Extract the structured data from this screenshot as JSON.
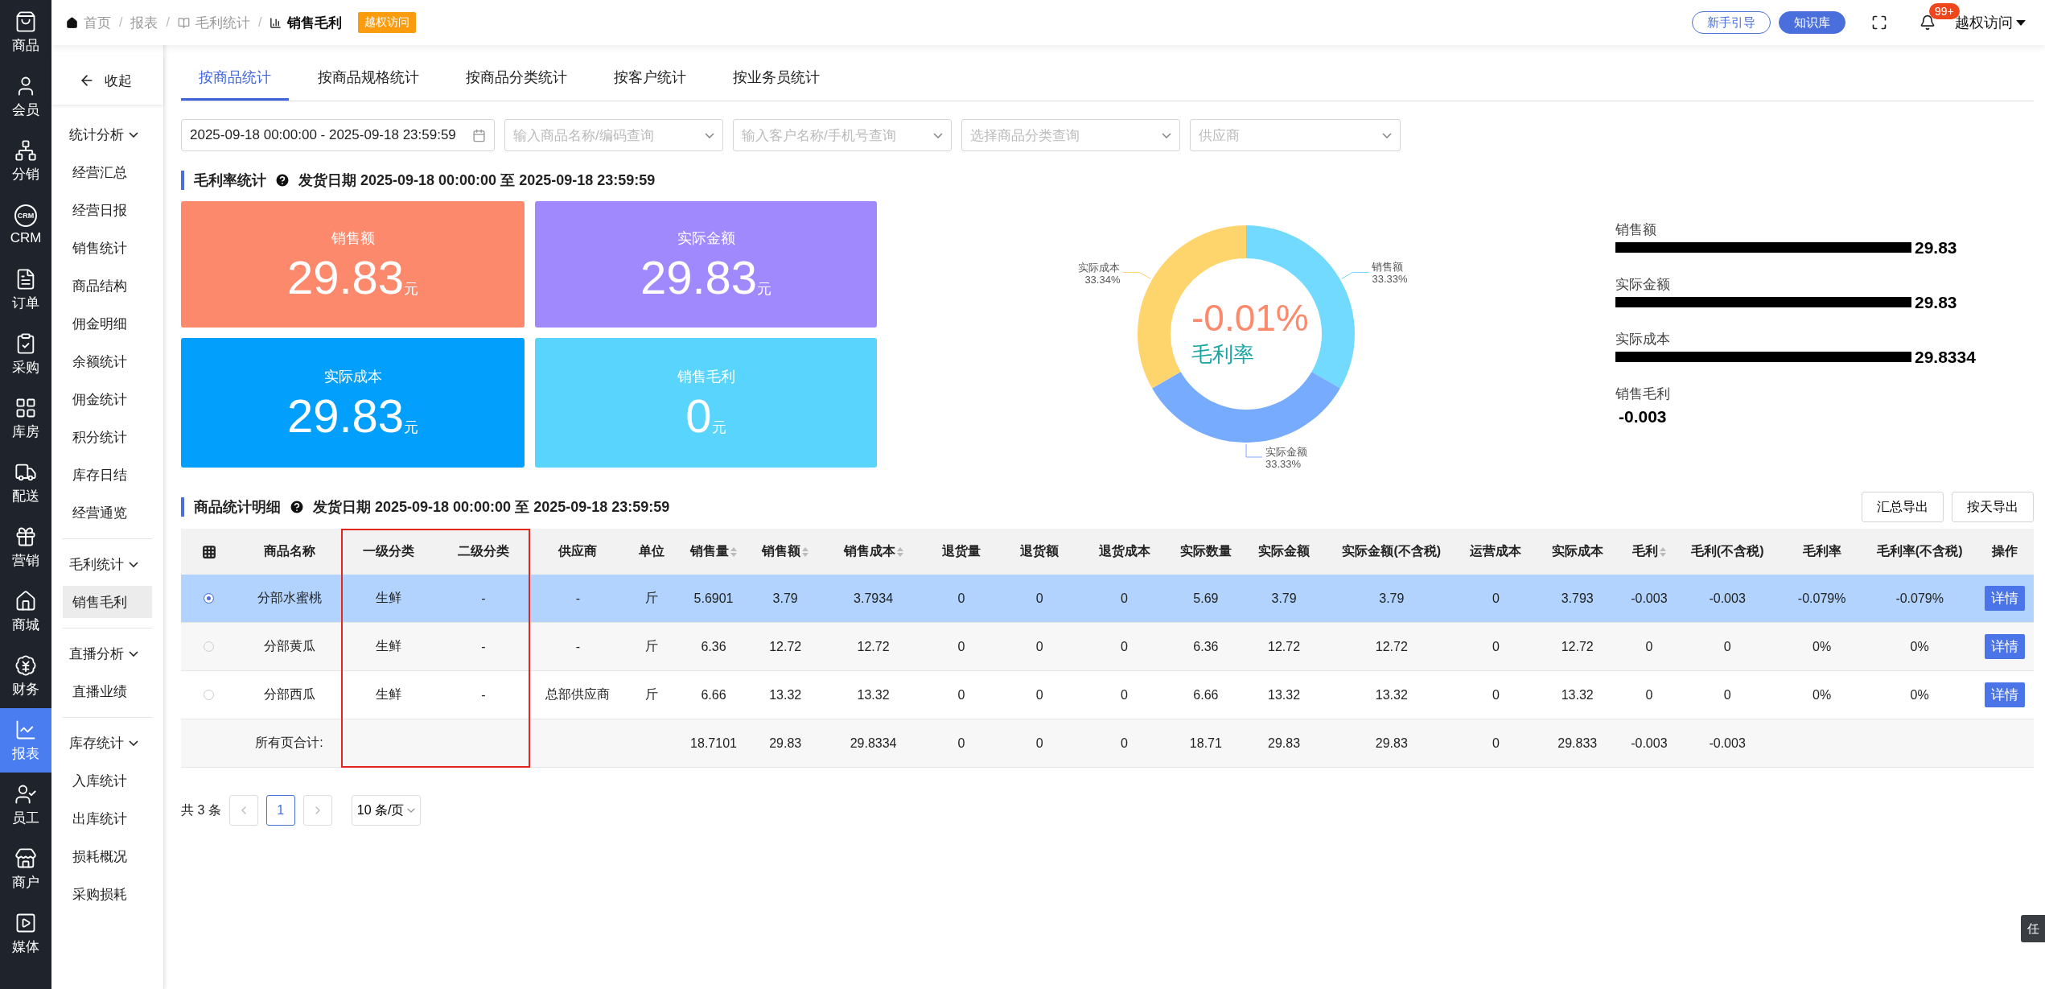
{
  "rail": [
    {
      "label": "商品",
      "selected": false
    },
    {
      "label": "会员",
      "selected": false
    },
    {
      "label": "分销",
      "selected": false
    },
    {
      "label": "CRM",
      "icon_text": "CRM",
      "selected": false
    },
    {
      "label": "订单",
      "selected": false
    },
    {
      "label": "采购",
      "selected": false
    },
    {
      "label": "库房",
      "selected": false
    },
    {
      "label": "配送",
      "selected": false
    },
    {
      "label": "营销",
      "selected": false
    },
    {
      "label": "商城",
      "selected": false
    },
    {
      "label": "财务",
      "selected": false
    },
    {
      "label": "报表",
      "selected": true
    },
    {
      "label": "员工",
      "selected": false
    },
    {
      "label": "商户",
      "selected": false
    },
    {
      "label": "媒体",
      "selected": false
    }
  ],
  "submenu": {
    "collapse": "收起",
    "groups": [
      {
        "title": "统计分析",
        "expanded": true,
        "items": [
          {
            "label": "经营汇总",
            "selected": false
          },
          {
            "label": "经营日报",
            "selected": false
          },
          {
            "label": "销售统计",
            "selected": false
          },
          {
            "label": "商品结构",
            "selected": false
          },
          {
            "label": "佣金明细",
            "selected": false
          },
          {
            "label": "余额统计",
            "selected": false
          },
          {
            "label": "佣金统计",
            "selected": false
          },
          {
            "label": "积分统计",
            "selected": false
          },
          {
            "label": "库存日结",
            "selected": false
          },
          {
            "label": "经营通览",
            "selected": false
          }
        ]
      },
      {
        "title": "毛利统计",
        "expanded": true,
        "items": [
          {
            "label": "销售毛利",
            "selected": true
          }
        ]
      },
      {
        "title": "直播分析",
        "expanded": true,
        "items": [
          {
            "label": "直播业绩",
            "selected": false
          }
        ]
      },
      {
        "title": "库存统计",
        "expanded": true,
        "items": [
          {
            "label": "入库统计",
            "selected": false
          },
          {
            "label": "出库统计",
            "selected": false
          },
          {
            "label": "损耗概况",
            "selected": false
          },
          {
            "label": "采购损耗",
            "selected": false
          }
        ]
      }
    ]
  },
  "breadcrumb": [
    {
      "label": "首页",
      "current": false
    },
    {
      "label": "报表",
      "current": false
    },
    {
      "label": "毛利统计",
      "current": false
    },
    {
      "label": "销售毛利",
      "current": true
    }
  ],
  "breadcrumb_separator": "/",
  "access_badge": "越权访问",
  "header_actions": {
    "guide": "新手引导",
    "knowledge": "知识库",
    "notifications": "99+",
    "user": "越权访问"
  },
  "tabs": [
    {
      "label": "按商品统计",
      "selected": true
    },
    {
      "label": "按商品规格统计",
      "selected": false
    },
    {
      "label": "按商品分类统计",
      "selected": false
    },
    {
      "label": "按客户统计",
      "selected": false
    },
    {
      "label": "按业务员统计",
      "selected": false
    }
  ],
  "filters": [
    {
      "kind": "date",
      "value": "2025-09-18 00:00:00 - 2025-09-18 23:59:59"
    },
    {
      "kind": "select",
      "placeholder": "输入商品名称/编码查询"
    },
    {
      "kind": "select",
      "placeholder": "输入客户名称/手机号查询"
    },
    {
      "kind": "select",
      "placeholder": "选择商品分类查询"
    },
    {
      "kind": "select",
      "placeholder": "供应商"
    }
  ],
  "summary": {
    "title": "毛利率统计",
    "subtitle": "发货日期 2025-09-18 00:00:00 至 2025-09-18 23:59:59",
    "cards": [
      {
        "label": "销售额",
        "value": "29.83",
        "unit": "元",
        "color": "#fd896c"
      },
      {
        "label": "实际金额",
        "value": "29.83",
        "unit": "元",
        "color": "#a088fd"
      },
      {
        "label": "实际成本",
        "value": "29.83",
        "unit": "元",
        "color": "#039ffd"
      },
      {
        "label": "销售毛利",
        "value": "0",
        "unit": "元",
        "color": "#59d5fd"
      }
    ],
    "donut_center": {
      "value": "-0.01%",
      "label": "毛利率"
    },
    "donut": {
      "chart_data": {
        "type": "donut",
        "categories": [
          "销售额",
          "实际金额",
          "实际成本"
        ],
        "values": [
          33.33,
          33.33,
          33.34
        ],
        "value_labels": [
          "33.33%",
          "33.33%",
          "33.34%"
        ]
      }
    },
    "bars": {
      "chart_data": {
        "type": "bar",
        "orientation": "horizontal",
        "categories": [
          "销售额",
          "实际金额",
          "实际成本",
          "销售毛利"
        ],
        "values": [
          29.83,
          29.83,
          29.8334,
          -0.003
        ],
        "value_labels": [
          "29.83",
          "29.83",
          "29.8334",
          "-0.003"
        ]
      }
    }
  },
  "detail": {
    "title": "商品统计明细",
    "subtitle": "发货日期 2025-09-18 00:00:00 至 2025-09-18 23:59:59",
    "exports": [
      "汇总导出",
      "按天导出"
    ]
  },
  "table": {
    "columns": [
      {
        "label": "商品名称",
        "sortable": false,
        "boxed": false
      },
      {
        "label": "一级分类",
        "sortable": false,
        "boxed": true
      },
      {
        "label": "二级分类",
        "sortable": false,
        "boxed": true
      },
      {
        "label": "供应商",
        "sortable": false,
        "boxed": false
      },
      {
        "label": "单位",
        "sortable": false,
        "boxed": false
      },
      {
        "label": "销售量",
        "sortable": true,
        "boxed": false
      },
      {
        "label": "销售额",
        "sortable": true,
        "boxed": false
      },
      {
        "label": "销售成本",
        "sortable": true,
        "boxed": false
      },
      {
        "label": "退货量",
        "sortable": false,
        "boxed": false
      },
      {
        "label": "退货额",
        "sortable": false,
        "boxed": false
      },
      {
        "label": "退货成本",
        "sortable": false,
        "boxed": false
      },
      {
        "label": "实际数量",
        "sortable": false,
        "boxed": false
      },
      {
        "label": "实际金额",
        "sortable": false,
        "boxed": false
      },
      {
        "label": "实际金额(不含税)",
        "sortable": false,
        "boxed": false
      },
      {
        "label": "运营成本",
        "sortable": false,
        "boxed": false
      },
      {
        "label": "实际成本",
        "sortable": false,
        "boxed": false
      },
      {
        "label": "毛利",
        "sortable": true,
        "boxed": false
      },
      {
        "label": "毛利(不含税)",
        "sortable": false,
        "boxed": false
      },
      {
        "label": "毛利率",
        "sortable": false,
        "boxed": false
      },
      {
        "label": "毛利率(不含税)",
        "sortable": false,
        "boxed": false
      },
      {
        "label": "操作",
        "sortable": false,
        "boxed": false
      }
    ],
    "rows": [
      {
        "kind": "item",
        "selected": true,
        "cells": [
          "分部水蜜桃",
          "生鲜",
          "-",
          "-",
          "斤",
          "5.6901",
          "3.79",
          "3.7934",
          "0",
          "0",
          "0",
          "5.69",
          "3.79",
          "3.79",
          "0",
          "3.793",
          "-0.003",
          "-0.003",
          "-0.079%",
          "-0.079%"
        ],
        "action": "详情"
      },
      {
        "kind": "item",
        "selected": false,
        "cells": [
          "分部黄瓜",
          "生鲜",
          "-",
          "-",
          "斤",
          "6.36",
          "12.72",
          "12.72",
          "0",
          "0",
          "0",
          "6.36",
          "12.72",
          "12.72",
          "0",
          "12.72",
          "0",
          "0",
          "0%",
          "0%"
        ],
        "action": "详情"
      },
      {
        "kind": "item",
        "selected": false,
        "cells": [
          "分部西瓜",
          "生鲜",
          "-",
          "总部供应商",
          "斤",
          "6.66",
          "13.32",
          "13.32",
          "0",
          "0",
          "0",
          "6.66",
          "13.32",
          "13.32",
          "0",
          "13.32",
          "0",
          "0",
          "0%",
          "0%"
        ],
        "action": "详情"
      },
      {
        "kind": "total",
        "cells": [
          "所有页合计:",
          null,
          null,
          null,
          null,
          "18.7101",
          "29.83",
          "29.8334",
          "0",
          "0",
          "0",
          "18.71",
          "29.83",
          "29.83",
          "0",
          "29.833",
          "-0.003",
          "-0.003",
          null,
          null
        ]
      }
    ]
  },
  "pagination": {
    "total": "共 3 条",
    "pages": [
      {
        "label": "1",
        "selected": true
      }
    ],
    "page_size": "10 条/页"
  },
  "side_tab": "任"
}
